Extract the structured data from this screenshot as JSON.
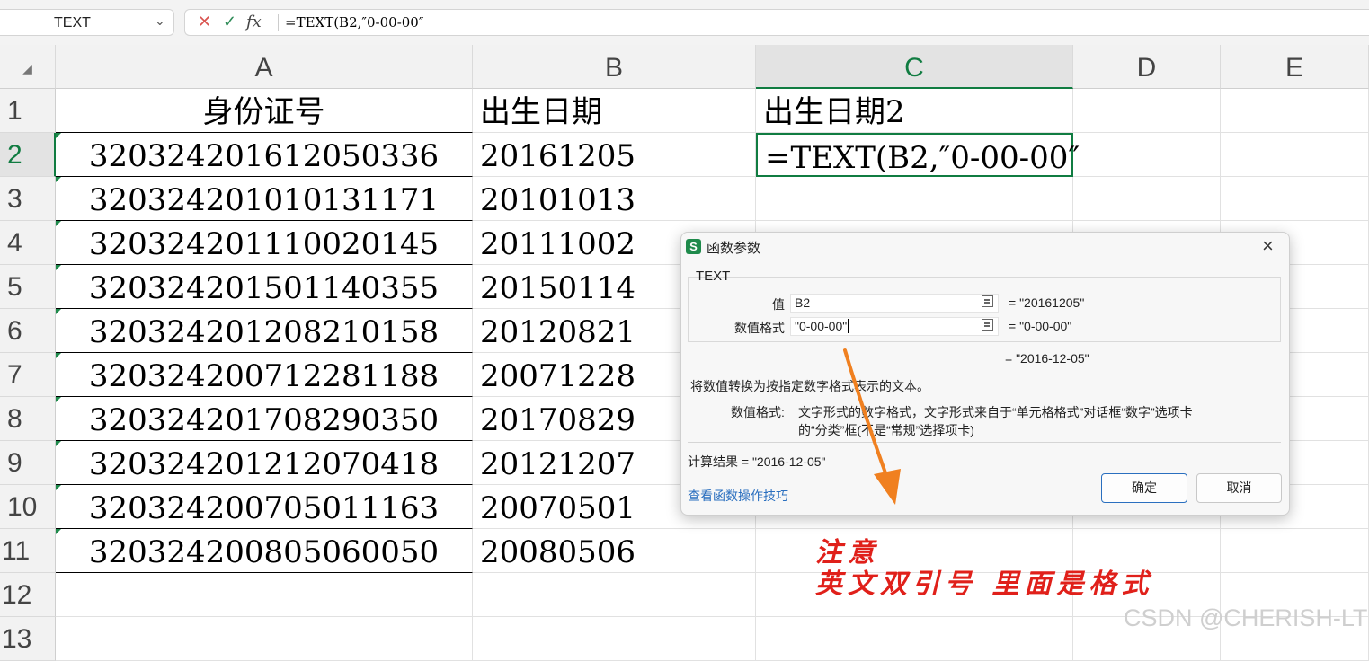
{
  "formula_bar": {
    "name_box": "TEXT",
    "formula": "=TEXT(B2,″0-00-00″"
  },
  "columns": [
    "A",
    "B",
    "C",
    "D",
    "E"
  ],
  "rows": [
    "1",
    "2",
    "3",
    "4",
    "5",
    "6",
    "7",
    "8",
    "9",
    "10",
    "11",
    "12",
    "13"
  ],
  "cells": {
    "header": [
      "身份证号",
      "出生日期",
      "出生日期2"
    ],
    "ids": [
      "320324201612050336",
      "320324201010131171",
      "320324201110020145",
      "320324201501140355",
      "320324201208210158",
      "320324200712281188",
      "320324201708290350",
      "320324201212070418",
      "320324200705011163",
      "320324200805060050"
    ],
    "dates": [
      "20161205",
      "20101013",
      "20111002",
      "20150114",
      "20120821",
      "20071228",
      "20170829",
      "20121207",
      "20070501",
      "20080506"
    ],
    "c2": "=TEXT(B2,″0-00-00″"
  },
  "dialog": {
    "title": "函数参数",
    "function_name": "TEXT",
    "arg1_label": "值",
    "arg1_value": "B2",
    "arg1_result": "= \"20161205\"",
    "arg2_label": "数值格式",
    "arg2_value": "\"0-00-00\"",
    "arg2_result": "= \"0-00-00\"",
    "overall_result": "= \"2016-12-05\"",
    "description": "将数值转换为按指定数字格式表示的文本。",
    "param_label": "数值格式:",
    "param_desc_1": "文字形式的数字格式，文字形式来自于“单元格格式”对话框“数字”选项卡",
    "param_desc_2": "的“分类”框(不是“常规”选择项卡)",
    "calc_result": "计算结果 = \"2016-12-05\"",
    "tips_link": "查看函数操作技巧",
    "ok_label": "确定",
    "cancel_label": "取消"
  },
  "annotation": {
    "line1": "注意",
    "line2": "英文双引号 里面是格式",
    "color": "#e0201a",
    "arrow_color": "#f08020"
  },
  "watermark": "CSDN @CHERISH-LT"
}
